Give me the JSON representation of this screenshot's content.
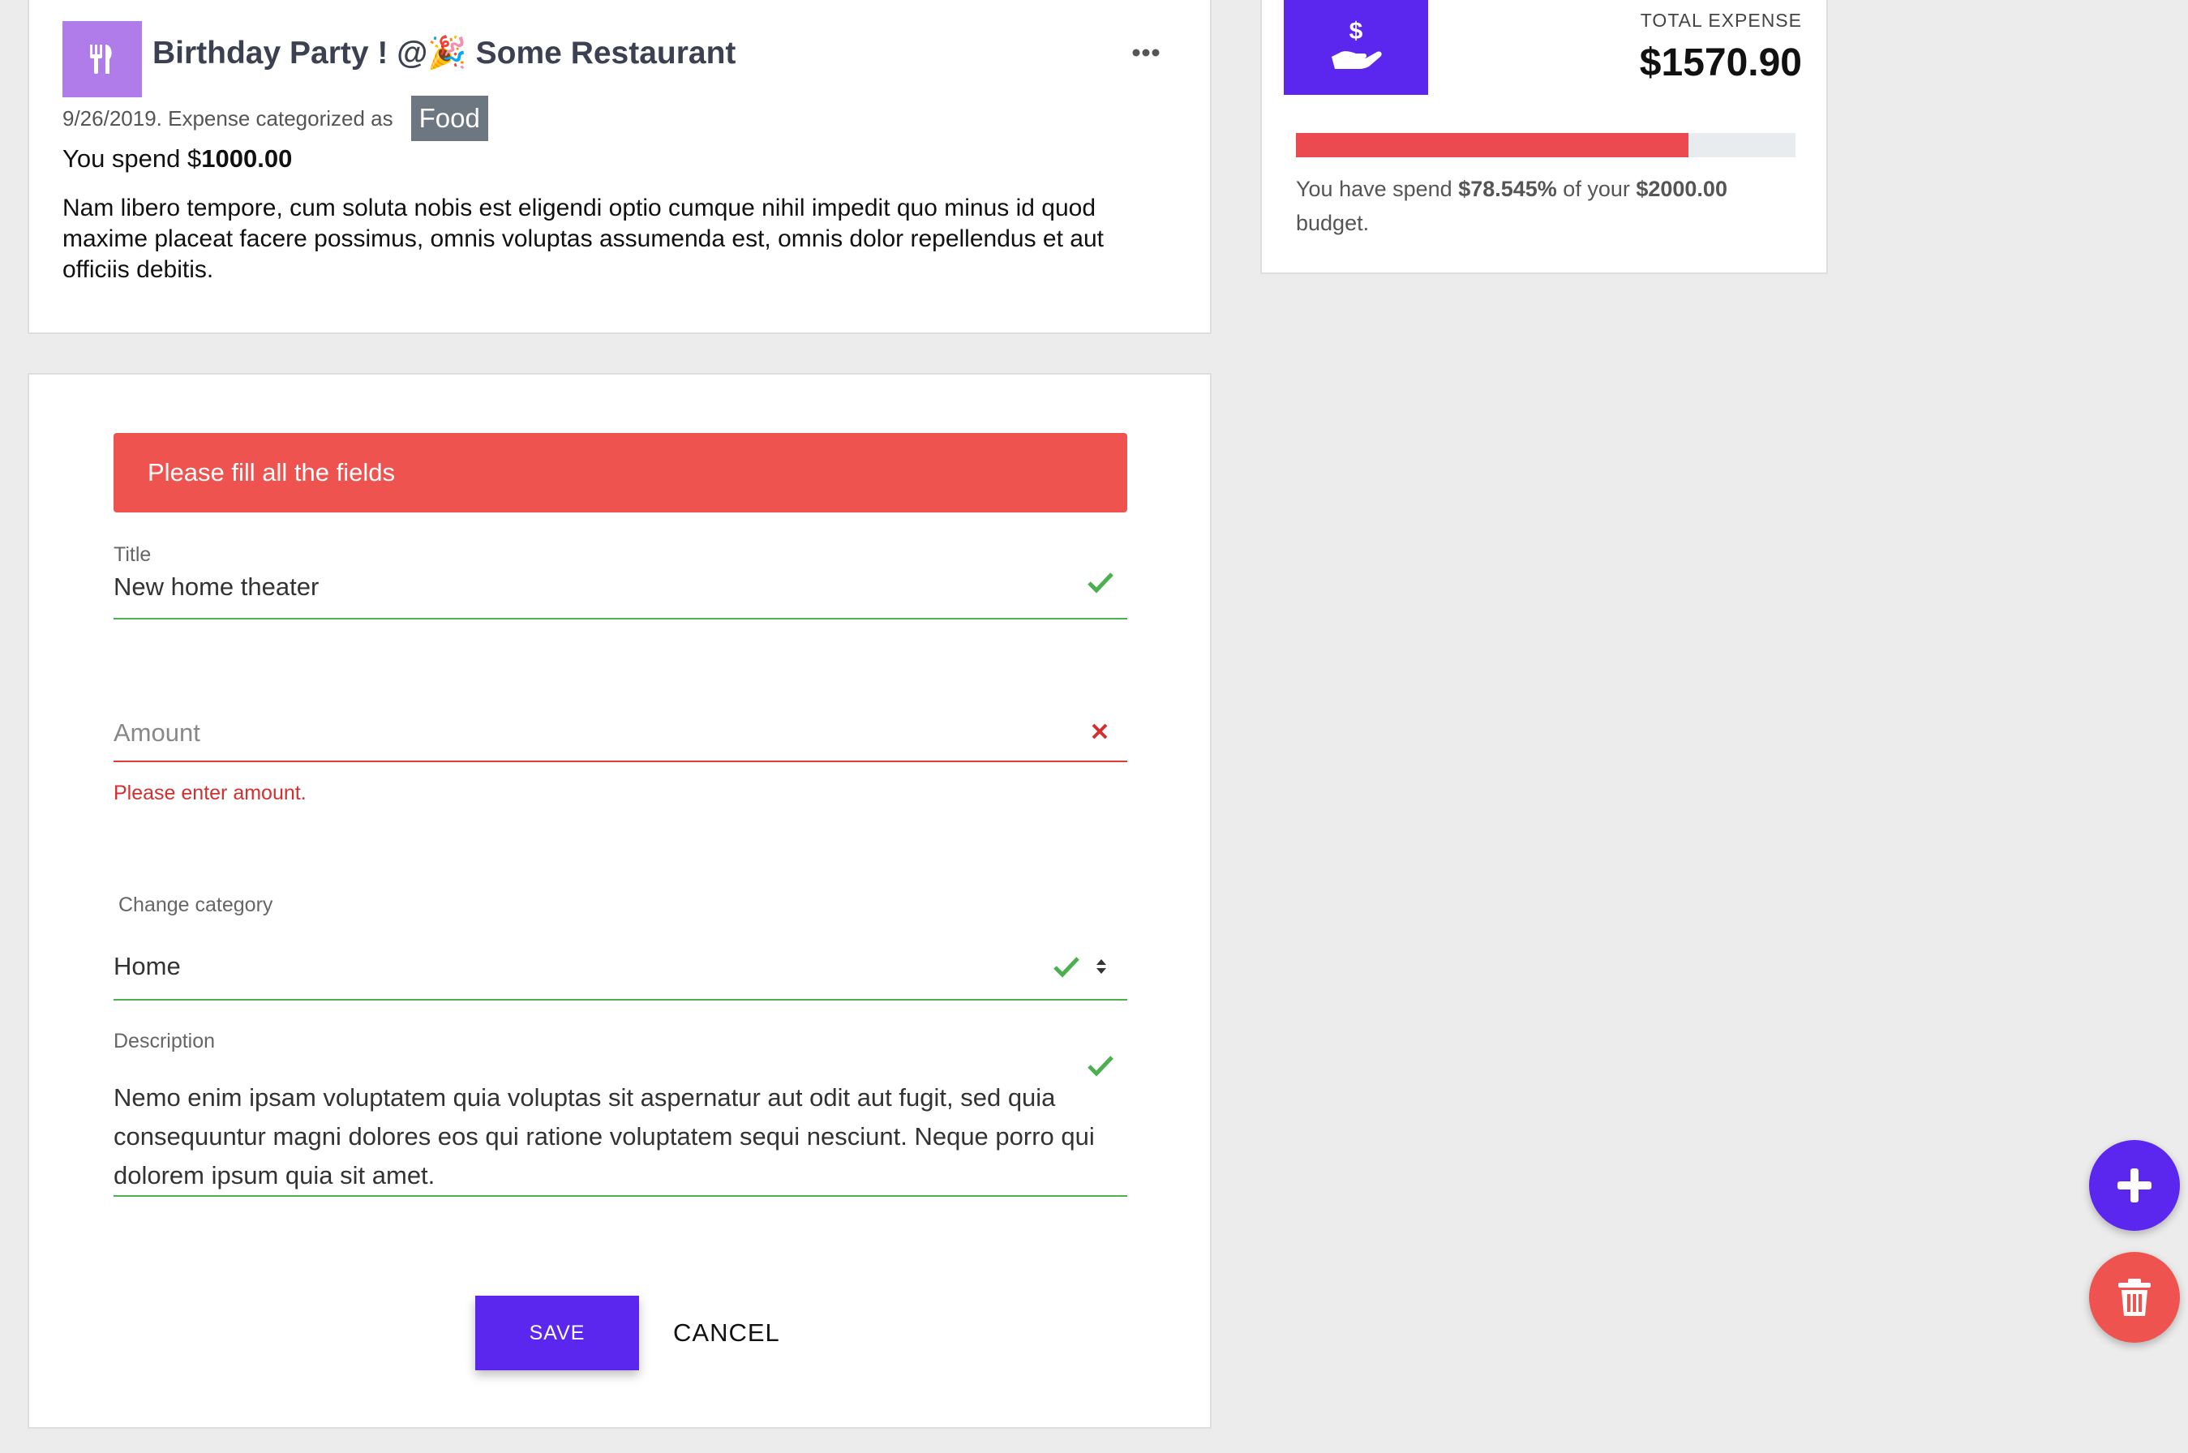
{
  "expense": {
    "title": "Birthday Party ! @🎉 Some Restaurant",
    "meta": "9/26/2019. Expense categorized as",
    "category": "Food",
    "spend_prefix": "You spend $",
    "spend_amount": "1000.00",
    "description": "Nam libero tempore, cum soluta nobis est eligendi optio cumque nihil impedit quo minus id quod maxime placeat facere possimus, omnis voluptas assumenda est, omnis dolor repellendus et aut officiis debitis."
  },
  "total": {
    "label": "TOTAL EXPENSE",
    "amount": "$1570.90",
    "progress_percent": 78.545,
    "budget_prefix": "You have spend ",
    "budget_percent": "$78.545%",
    "budget_mid": " of your ",
    "budget_amount": "$2000.00",
    "budget_suffix": " budget."
  },
  "form": {
    "alert": "Please fill all the fields",
    "title_label": "Title",
    "title_value": "New home theater",
    "amount_placeholder": "Amount",
    "amount_error": "Please enter amount.",
    "category_label": "Change category",
    "category_value": "Home",
    "description_label": "Description",
    "description_value": "Nemo enim ipsam voluptatem quia voluptas sit aspernatur aut odit aut fugit, sed quia consequuntur magni dolores eos qui ratione voluptatem sequi nesciunt. Neque porro qui dolorem ipsum quia sit amet.",
    "save_label": "SAVE",
    "cancel_label": "CANCEL"
  },
  "colors": {
    "accent": "#5b26ee",
    "danger": "#ef5350",
    "success": "#4caf50",
    "food_category": "#b07cea"
  },
  "icons": {
    "category": "fork-knife-icon",
    "total": "hand-dollar-icon",
    "more": "ellipsis-icon",
    "add": "plus-icon",
    "delete": "trash-icon"
  }
}
